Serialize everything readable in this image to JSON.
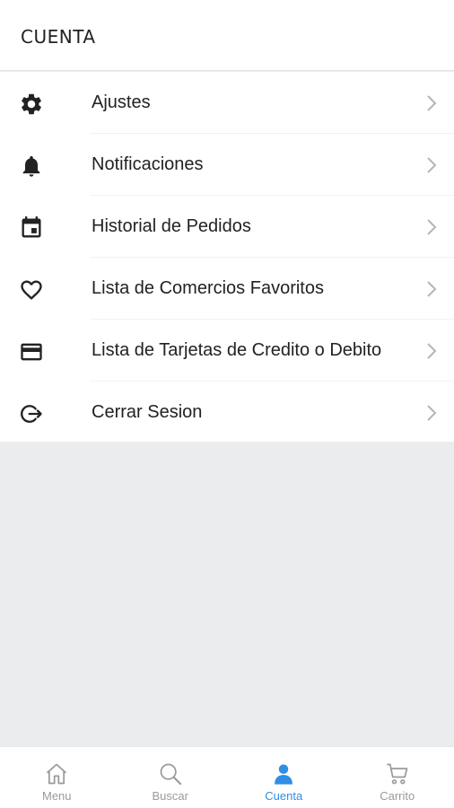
{
  "header": {
    "title": "CUENTA"
  },
  "menu": {
    "items": [
      {
        "label": "Ajustes",
        "icon": "gear-icon"
      },
      {
        "label": "Notificaciones",
        "icon": "bell-icon"
      },
      {
        "label": "Historial de Pedidos",
        "icon": "calendar-icon"
      },
      {
        "label": "Lista de Comercios Favoritos",
        "icon": "heart-icon"
      },
      {
        "label": "Lista de Tarjetas de Credito o Debito",
        "icon": "credit-card-icon"
      },
      {
        "label": "Cerrar Sesion",
        "icon": "logout-icon"
      }
    ]
  },
  "bottom_nav": {
    "items": [
      {
        "label": "Menu",
        "icon": "home-icon",
        "active": false
      },
      {
        "label": "Buscar",
        "icon": "search-icon",
        "active": false
      },
      {
        "label": "Cuenta",
        "icon": "user-icon",
        "active": true
      },
      {
        "label": "Carrito",
        "icon": "cart-icon",
        "active": false
      }
    ]
  },
  "colors": {
    "accent": "#2f8ee6",
    "inactive": "#9a9a9a",
    "background": "#ebecee",
    "text": "#222222"
  }
}
